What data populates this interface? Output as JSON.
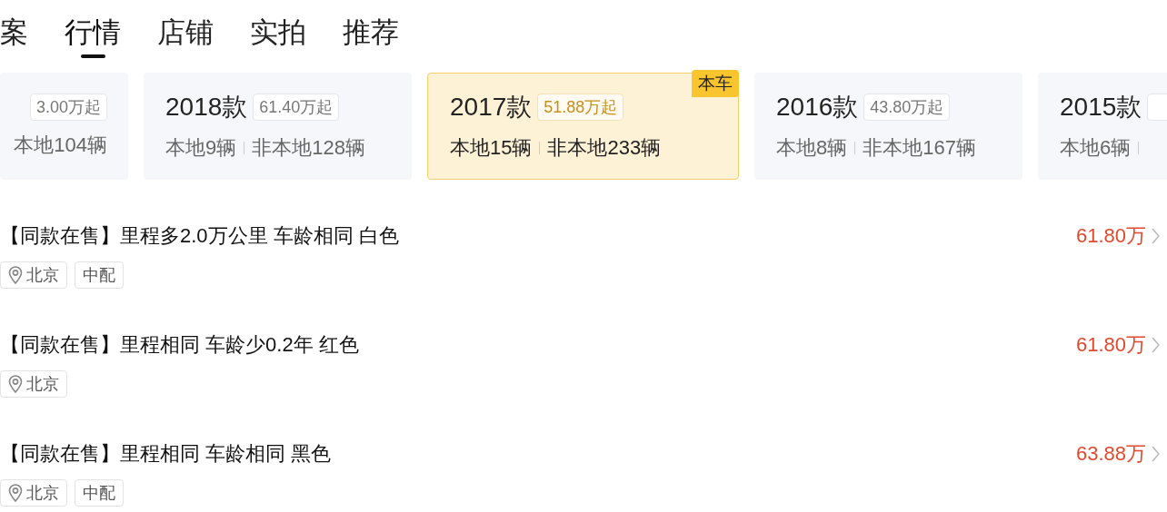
{
  "tabs": [
    {
      "label": "案",
      "selected": false
    },
    {
      "label": "行情",
      "selected": true
    },
    {
      "label": "店铺",
      "selected": false
    },
    {
      "label": "实拍",
      "selected": false
    },
    {
      "label": "推荐",
      "selected": false
    }
  ],
  "year_cards": [
    {
      "price": "3.00万起",
      "counts": [
        "本地104辆"
      ],
      "selected": false
    },
    {
      "year": "2018款",
      "price": "61.40万起",
      "counts": [
        "本地9辆",
        "非本地128辆"
      ],
      "selected": false
    },
    {
      "year": "2017款",
      "price": "51.88万起",
      "counts": [
        "本地15辆",
        "非本地233辆"
      ],
      "selected": true,
      "badge": "本车"
    },
    {
      "year": "2016款",
      "price": "43.80万起",
      "counts": [
        "本地8辆",
        "非本地167辆"
      ],
      "selected": false
    },
    {
      "year": "2015款",
      "counts": [
        "本地6辆"
      ],
      "selected": false
    }
  ],
  "listings": [
    {
      "title": "【同款在售】里程多2.0万公里 车龄相同 白色",
      "price": "61.80万",
      "tags": [
        {
          "kind": "location",
          "text": "北京"
        },
        {
          "kind": "plain",
          "text": "中配"
        }
      ]
    },
    {
      "title": "【同款在售】里程相同 车龄少0.2年 红色",
      "price": "61.80万",
      "tags": [
        {
          "kind": "location",
          "text": "北京"
        }
      ]
    },
    {
      "title": "【同款在售】里程相同 车龄相同 黑色",
      "price": "63.88万",
      "tags": [
        {
          "kind": "location",
          "text": "北京"
        },
        {
          "kind": "plain",
          "text": "中配"
        }
      ]
    }
  ]
}
